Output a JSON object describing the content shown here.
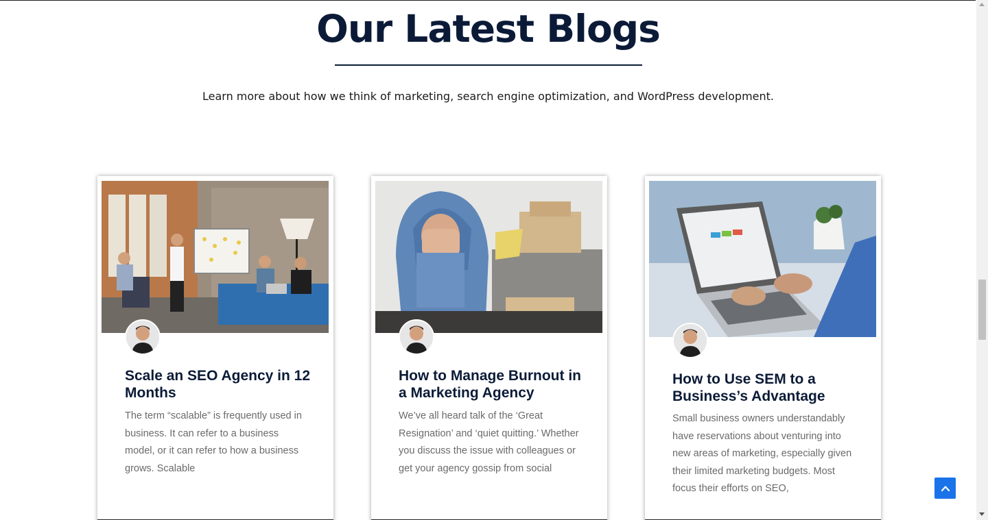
{
  "section": {
    "title": "Our Latest Blogs",
    "subtitle": "Learn more about how we think of marketing, search engine optimization, and WordPress development."
  },
  "posts": [
    {
      "title": "Scale an SEO Agency in 12 Months",
      "excerpt": "The term “scalable” is frequently used in business. It can refer to a business model, or it can refer to how a business grows. Scalable",
      "image": "team-meeting-whiteboard-photo",
      "avatar": "author-avatar"
    },
    {
      "title": "How to Manage Burnout in a Marketing Agency",
      "excerpt": "We’ve all heard talk of the ‘Great Resignation’ and ‘quiet quitting.’ Whether you discuss the issue with colleagues or get your agency gossip from social",
      "image": "stressed-person-hoodie-photo",
      "avatar": "author-avatar"
    },
    {
      "title": "How to Use SEM to a Business’s Advantage",
      "excerpt": "Small business owners understandably have reservations about venturing into new areas of marketing, especially given their limited marketing budgets. Most focus their efforts on SEO,",
      "image": "laptop-typing-photo",
      "avatar": "author-avatar"
    }
  ],
  "icons": {
    "back_to_top": "chevron-up-icon"
  },
  "colors": {
    "heading": "#0b1b37",
    "accent": "#1a73e8",
    "body_text": "#6a6a6a"
  }
}
